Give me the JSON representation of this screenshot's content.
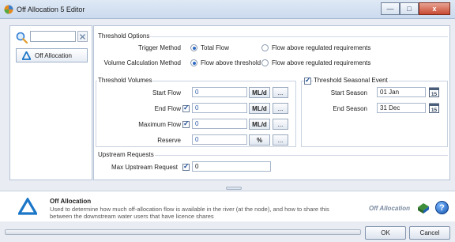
{
  "window": {
    "title": "Off Allocation 5 Editor",
    "min": "—",
    "max": "□",
    "close": "x"
  },
  "sidebar": {
    "search_value": "",
    "items": [
      {
        "label": "Off Allocation"
      }
    ]
  },
  "threshold_options": {
    "title": "Threshold Options",
    "trigger_label": "Trigger Method",
    "trigger_options": [
      "Total Flow",
      "Flow above regulated requirements"
    ],
    "trigger_selected": 0,
    "volume_label": "Volume Calculation Method",
    "volume_options": [
      "Flow above threshold",
      "Flow above regulated requirements"
    ],
    "volume_selected": 0
  },
  "threshold_volumes": {
    "title": "Threshold Volumes",
    "rows": [
      {
        "label": "Start Flow",
        "checkbox": false,
        "value": "0",
        "unit": "ML/d",
        "dots": "..."
      },
      {
        "label": "End Flow",
        "checkbox": true,
        "value": "0",
        "unit": "ML/d",
        "dots": "..."
      },
      {
        "label": "Maximum Flow",
        "checkbox": true,
        "value": "0",
        "unit": "ML/d",
        "dots": "..."
      },
      {
        "label": "Reserve",
        "checkbox": false,
        "value": "0",
        "unit": "%",
        "dots": "..."
      }
    ]
  },
  "seasonal": {
    "title": "Threshold Seasonal Event",
    "checked": true,
    "start_label": "Start Season",
    "start_value": "01 Jan",
    "end_label": "End Season",
    "end_value": "31 Dec",
    "cal_day": "15"
  },
  "upstream": {
    "title": "Upstream Requests",
    "label": "Max Upstream Request",
    "checked": true,
    "value": "0"
  },
  "help": {
    "title": "Off Allocation",
    "description": "Used to determine how much off-allocation flow is available in the river (at the node), and how to share this between the downstream water users that have licence shares",
    "brand": "Off Allocation",
    "question": "?"
  },
  "buttons": {
    "ok": "OK",
    "cancel": "Cancel"
  },
  "colors": {
    "accent": "#2e6bc3",
    "value_text": "#2f5fa8"
  }
}
